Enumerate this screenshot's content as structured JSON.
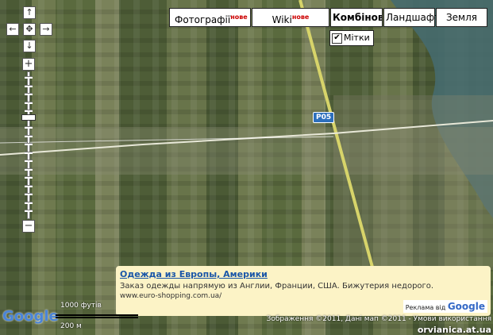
{
  "map_types": [
    {
      "label": "Фотографії",
      "badge": "нове"
    },
    {
      "label": "Wiki",
      "badge": "нове"
    },
    {
      "label": "Комбінован",
      "badge": ""
    },
    {
      "label": "Ландшафт",
      "badge": ""
    },
    {
      "label": "Земля",
      "badge": ""
    }
  ],
  "labels_toggle": {
    "label": "Мітки",
    "checked": true
  },
  "road_shield": "P05",
  "ad": {
    "title": "Одежда из Европы, Америки",
    "description": "Заказ одежды напрямую из Англии, Франции, США. Бижутерия недорого.",
    "url": "www.euro-shopping.com.ua/",
    "attribution_prefix": "Реклама від",
    "attribution_brand": "Google"
  },
  "logo": "Google",
  "scale": {
    "imperial": "1000 футів",
    "metric": "200 м"
  },
  "copyright": "Зображення ©2011, Дані мап ©2011 - Умови використання",
  "watermark": "orvianica.at.ua",
  "zoom": {
    "in_symbol": "+",
    "out_symbol": "−",
    "level_fraction": 0.3
  },
  "nav_arrows": {
    "up": "↑",
    "down": "↓",
    "left": "←",
    "right": "→",
    "center": "✥"
  },
  "colors": {
    "river": "#466a6e",
    "road": "#d7d46a",
    "ad_bg": "#fcf3c6",
    "link": "#1a57a8"
  }
}
